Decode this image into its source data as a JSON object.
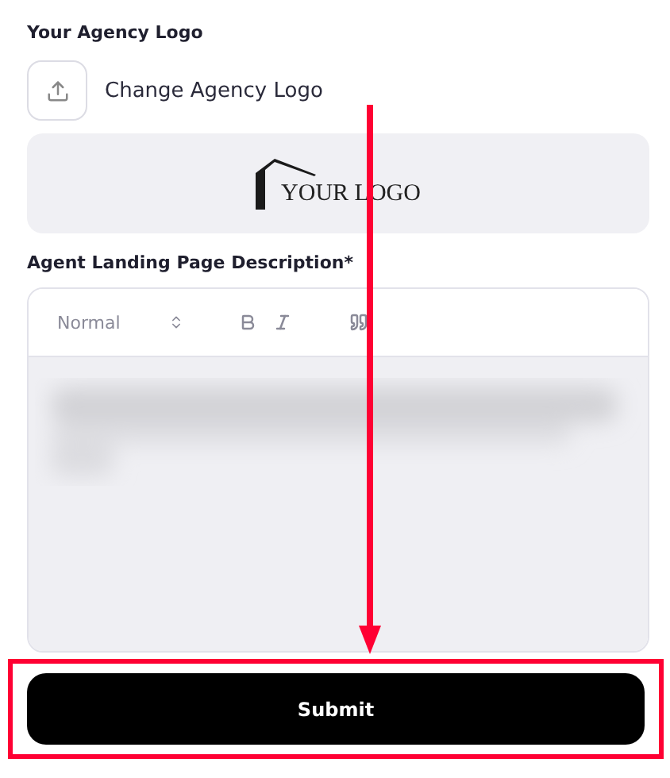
{
  "logo_section": {
    "label": "Your Agency Logo",
    "change_button": "Change Agency Logo",
    "preview_text": "YOUR LOGO"
  },
  "description": {
    "label": "Agent Landing Page Description*",
    "toolbar": {
      "format": "Normal",
      "tools": [
        {
          "kind": "bold"
        },
        {
          "kind": "italic"
        },
        {
          "kind": "quote"
        }
      ]
    }
  },
  "submit": "Submit"
}
